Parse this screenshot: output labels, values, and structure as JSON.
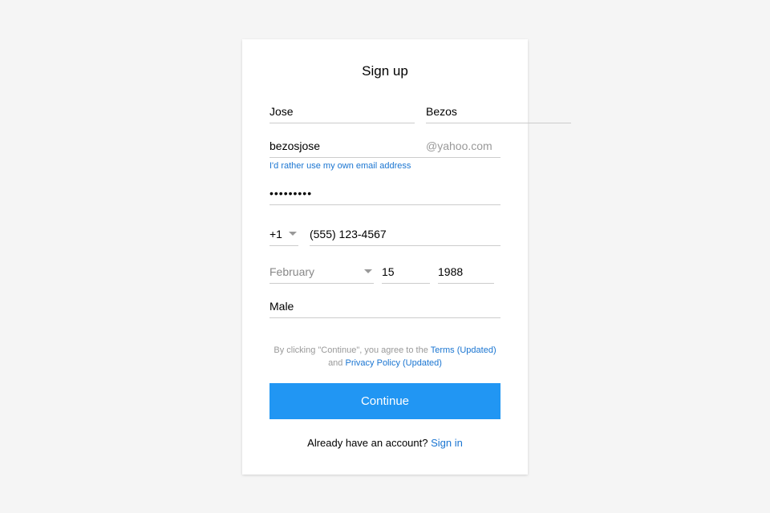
{
  "title": "Sign up",
  "name": {
    "first": "Jose",
    "last": "Bezos"
  },
  "email": {
    "username": "bezosjose",
    "domain": "@yahoo.com"
  },
  "alt_email_link": "I'd rather use my own email address",
  "password_masked": "•••••••••",
  "phone": {
    "country_code": "+1",
    "number": "(555) 123-4567"
  },
  "dob": {
    "month": "February",
    "day": "15",
    "year": "1988"
  },
  "gender": "Male",
  "terms": {
    "prefix": "By clicking \"Continue\", you agree to the ",
    "terms_link": "Terms (Updated)",
    "middle": " and ",
    "privacy_link": "Privacy Policy (Updated)"
  },
  "continue_label": "Continue",
  "signin": {
    "prompt": "Already have an account? ",
    "link": "Sign in"
  }
}
